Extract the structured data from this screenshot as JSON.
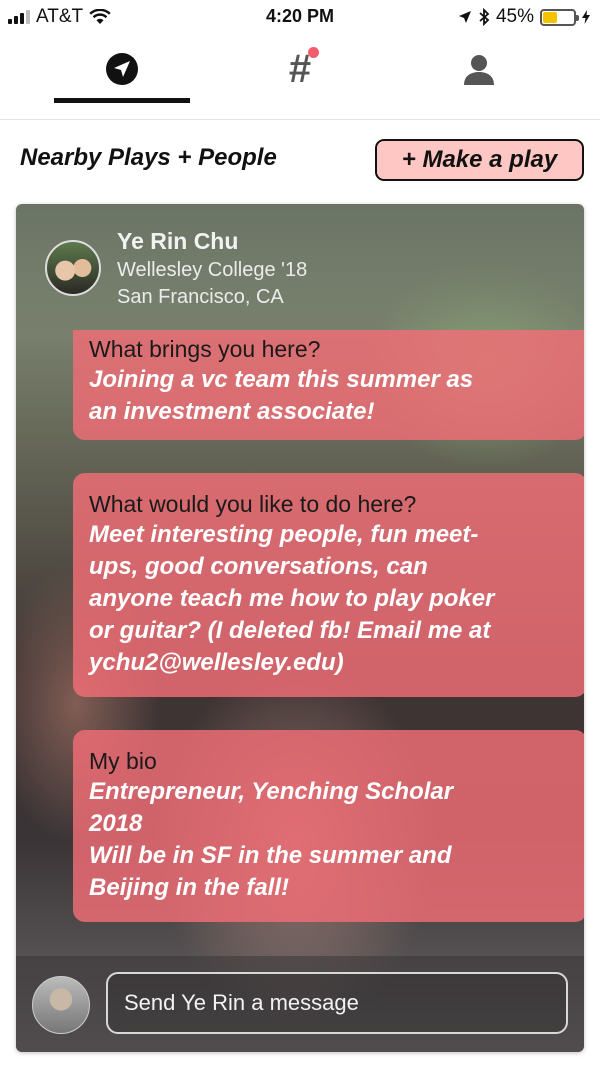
{
  "status_bar": {
    "carrier": "AT&T",
    "time": "4:20 PM",
    "battery": "45%",
    "battery_level": 0.45,
    "icons": [
      "signal-icon",
      "wifi-icon",
      "location-arrow-icon",
      "bluetooth-icon",
      "battery-icon",
      "charging-icon"
    ]
  },
  "tabs": [
    {
      "icon": "navigation-icon",
      "active": true
    },
    {
      "icon": "hashtag-icon",
      "label": "#",
      "notification": true
    },
    {
      "icon": "profile-icon"
    }
  ],
  "header": {
    "title": "Nearby Plays + People",
    "make_play_label": "+ Make a play"
  },
  "profile": {
    "name": "Ye Rin Chu",
    "school": "Wellesley College '18",
    "location": "San Francisco, CA"
  },
  "prompts": [
    {
      "question": "What brings you here?",
      "answer": "Joining a vc team this summer as\nan investment associate!"
    },
    {
      "question": "What would you like to do here?",
      "answer": "Meet interesting people, fun meet-\nups, good conversations, can\nanyone teach me how to play poker\nor guitar? (I deleted fb! Email me at\nychu2@wellesley.edu)"
    },
    {
      "question": "My bio",
      "answer": "Entrepreneur, Yenching Scholar\n2018\nWill be in SF in the summer and\nBeijing in the fall!"
    }
  ],
  "composer": {
    "placeholder": "Send Ye Rin a message"
  },
  "colors": {
    "accent": "#f26e76",
    "button_bg": "#ffc7c3",
    "notification": "#f25c6c",
    "battery": "#f5c400"
  }
}
